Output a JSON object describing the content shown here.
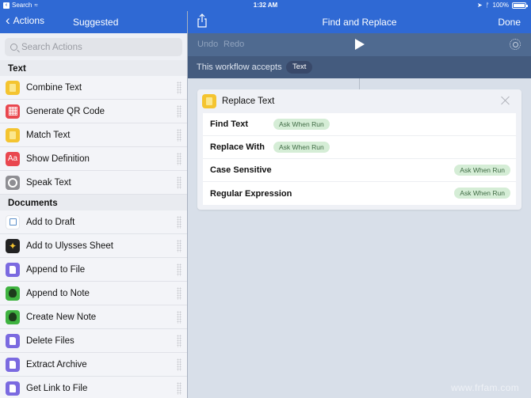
{
  "status_bar": {
    "back_app": "Search",
    "time": "1:32 AM",
    "battery": "100%"
  },
  "left_nav": {
    "back_label": "Actions",
    "title": "Suggested"
  },
  "right_nav": {
    "title": "Find and Replace",
    "done_label": "Done"
  },
  "sidebar": {
    "search_placeholder": "Search Actions",
    "sections": [
      {
        "title": "Text",
        "items": [
          {
            "label": "Combine Text",
            "icon": "text-icon"
          },
          {
            "label": "Generate QR Code",
            "icon": "qr-code-icon"
          },
          {
            "label": "Match Text",
            "icon": "text-icon"
          },
          {
            "label": "Show Definition",
            "icon": "dictionary-icon"
          },
          {
            "label": "Speak Text",
            "icon": "settings-icon"
          }
        ]
      },
      {
        "title": "Documents",
        "items": [
          {
            "label": "Add to Draft",
            "icon": "drafts-icon"
          },
          {
            "label": "Add to Ulysses Sheet",
            "icon": "ulysses-icon"
          },
          {
            "label": "Append to File",
            "icon": "file-icon"
          },
          {
            "label": "Append to Note",
            "icon": "evernote-icon"
          },
          {
            "label": "Create New Note",
            "icon": "evernote-icon"
          },
          {
            "label": "Delete Files",
            "icon": "file-icon"
          },
          {
            "label": "Extract Archive",
            "icon": "file-icon"
          },
          {
            "label": "Get Link to File",
            "icon": "file-icon"
          }
        ]
      }
    ]
  },
  "toolbar": {
    "undo_label": "Undo",
    "redo_label": "Redo"
  },
  "accepts": {
    "label": "This workflow accepts",
    "type": "Text"
  },
  "action_card": {
    "title": "Replace Text",
    "params": [
      {
        "name": "Find Text",
        "value": "Ask When Run"
      },
      {
        "name": "Replace With",
        "value": "Ask When Run"
      },
      {
        "name": "Case Sensitive",
        "value": "Ask When Run"
      },
      {
        "name": "Regular Expression",
        "value": "Ask When Run"
      }
    ]
  },
  "watermark": "www.frfam.com"
}
